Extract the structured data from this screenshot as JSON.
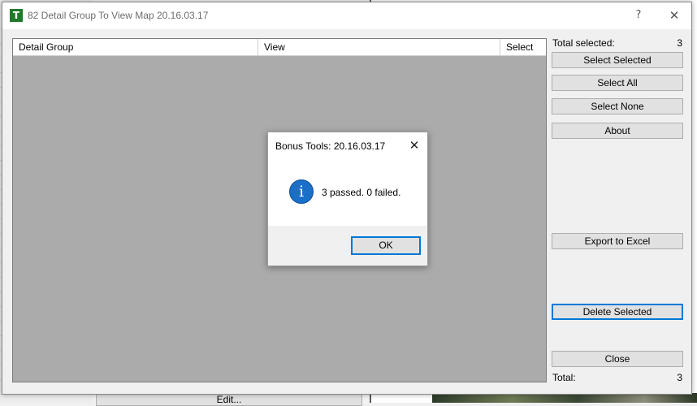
{
  "background": {
    "edit_button_label": "Edit..."
  },
  "window": {
    "title": "82 Detail Group To View Map 20.16.03.17",
    "help_glyph": "?",
    "close_glyph": "✕",
    "icon": "app-icon"
  },
  "grid": {
    "columns": [
      "Detail Group",
      "View",
      "Select"
    ]
  },
  "panel": {
    "total_selected_label": "Total selected:",
    "total_selected_value": "3",
    "buttons": {
      "select_selected": "Select Selected",
      "select_all": "Select All",
      "select_none": "Select None",
      "about": "About",
      "export_to_excel": "Export to Excel",
      "delete_selected": "Delete Selected",
      "close": "Close"
    },
    "total_label": "Total:",
    "total_value": "3"
  },
  "message_box": {
    "title": "Bonus Tools: 20.16.03.17",
    "close_glyph": "✕",
    "icon": "info-icon",
    "message": "3 passed. 0 failed.",
    "ok_label": "OK"
  },
  "colors": {
    "accent": "#0078d7",
    "grid_background": "#ababab",
    "info_icon": "#1a6fc9"
  }
}
